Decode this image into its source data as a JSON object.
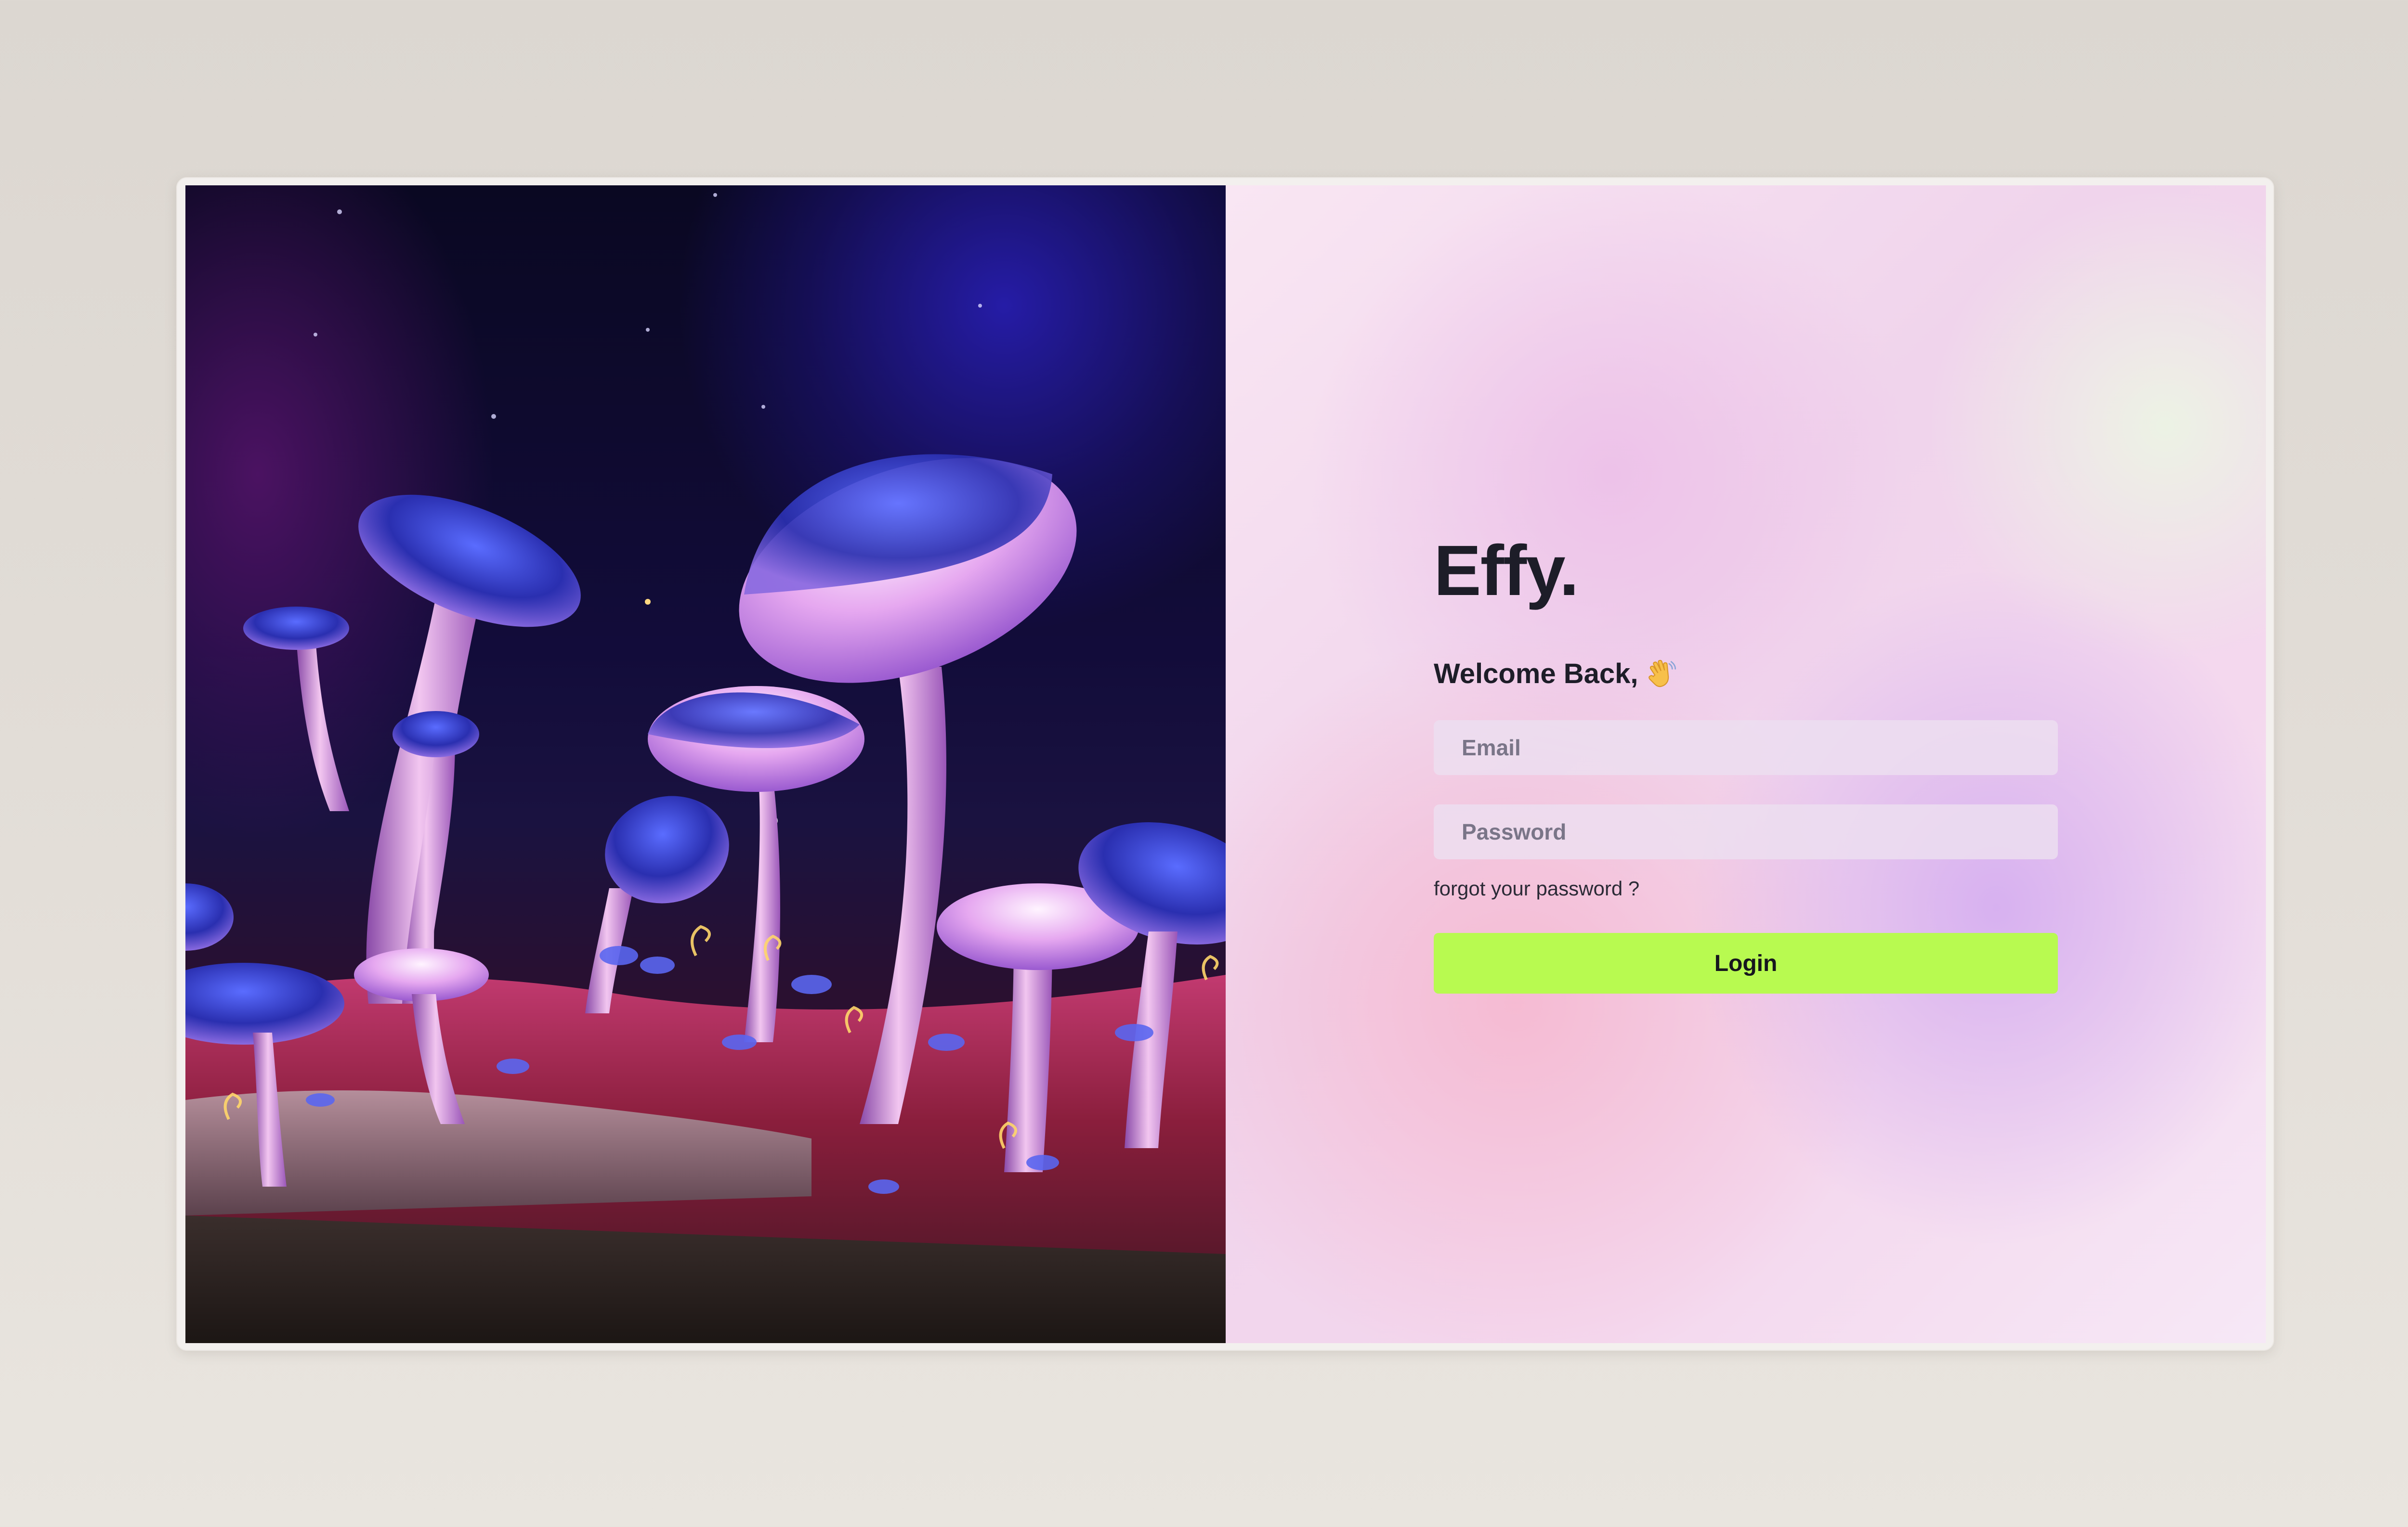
{
  "brand": {
    "logo": "Effy."
  },
  "login_form": {
    "welcome_text": "Welcome Back,",
    "welcome_icon": "waving-hand-icon",
    "email": {
      "value": "",
      "placeholder": "Email"
    },
    "password": {
      "value": "",
      "placeholder": "Password"
    },
    "forgot_link": "forgot your password ?",
    "login_label": "Login"
  },
  "hero_image": {
    "subject": "glowing-mushroom-forest-illustration"
  },
  "colors": {
    "accent": "#b8fa50",
    "text": "#1d1d28",
    "page_background": "#e2ddd7"
  }
}
